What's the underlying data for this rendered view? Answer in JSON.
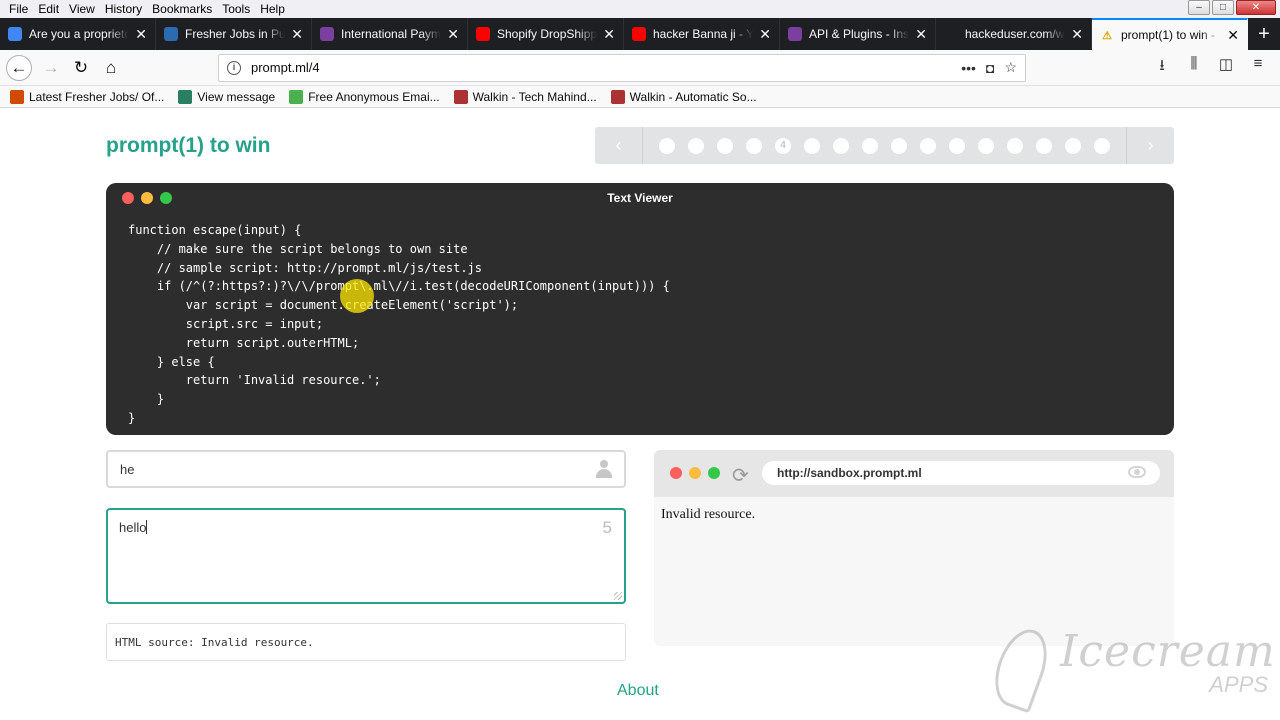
{
  "menubar": {
    "items": [
      "File",
      "Edit",
      "View",
      "History",
      "Bookmarks",
      "Tools",
      "Help"
    ]
  },
  "window_controls": {
    "minimize": "–",
    "maximize": "□",
    "close": "✕"
  },
  "tabs": [
    {
      "title": "Are you a proprietor",
      "icon": "google-icon",
      "color": "#4285f4",
      "active": false
    },
    {
      "title": "Fresher Jobs in Pune",
      "icon": "freshersworld-icon",
      "color": "#2b6cb0",
      "active": false
    },
    {
      "title": "International Payme",
      "icon": "payment-icon",
      "color": "#7b3fa0",
      "active": false
    },
    {
      "title": "Shopify DropShippin",
      "icon": "youtube-icon",
      "color": "#ff0000",
      "active": false
    },
    {
      "title": "hacker Banna ji - Yo",
      "icon": "youtube-icon",
      "color": "#ff0000",
      "active": false
    },
    {
      "title": "API & Plugins - Inst",
      "icon": "plugin-icon",
      "color": "#7b3fa0",
      "active": false
    },
    {
      "title": "hackeduser.com/wp-co",
      "icon": "blank-icon",
      "color": "#1e1f22",
      "active": false
    },
    {
      "title": "prompt(1) to win -",
      "icon": "warning-icon",
      "color": "#f0b400",
      "active": true
    }
  ],
  "new_tab_label": "+",
  "navbar": {
    "back": "←",
    "forward": "→",
    "reload": "↻",
    "home": "⌂",
    "url": "prompt.ml/4",
    "page_actions": "•••",
    "pocket": "◘",
    "bookmark_star": "☆",
    "tools": [
      "⭳",
      "⫼",
      "◫",
      "≡"
    ]
  },
  "bookmarks": [
    {
      "label": "Latest Fresher Jobs/ Of...",
      "color": "#d04a02"
    },
    {
      "label": "View message",
      "color": "#2a7f62"
    },
    {
      "label": "Free Anonymous Emai...",
      "color": "#4caf50"
    },
    {
      "label": "Walkin - Tech Mahind...",
      "color": "#a33"
    },
    {
      "label": "Walkin - Automatic So...",
      "color": "#a33"
    }
  ],
  "page": {
    "title": "prompt(1) to win",
    "pager": {
      "prev": "‹",
      "next": "›",
      "current": "4",
      "dots": [
        "",
        "",
        "",
        "",
        "4",
        "",
        "",
        "",
        "",
        "",
        "",
        "",
        "",
        "",
        "",
        ""
      ]
    },
    "viewer": {
      "title": "Text Viewer",
      "code": "function escape(input) {\n    // make sure the script belongs to own site\n    // sample script: http://prompt.ml/js/test.js\n    if (/^(?:https?:)?\\/\\/prompt\\.ml\\//i.test(decodeURIComponent(input))) {\n        var script = document.createElement('script');\n        script.src = input;\n        return script.outerHTML;\n    } else {\n        return 'Invalid resource.';\n    }\n}"
    },
    "input": {
      "value": "he"
    },
    "textarea": {
      "value": "hello",
      "counter": "5"
    },
    "html_source": "HTML source: Invalid resource.",
    "sandbox": {
      "url": "http://sandbox.prompt.ml",
      "content": "Invalid resource."
    },
    "about_link": "About"
  },
  "watermark": {
    "text": "Icecream",
    "sub": "APPS"
  },
  "colors": {
    "accent": "#26a28a",
    "viewer_bg": "#2d2d2d",
    "tab_active_top": "#0a84ff"
  }
}
